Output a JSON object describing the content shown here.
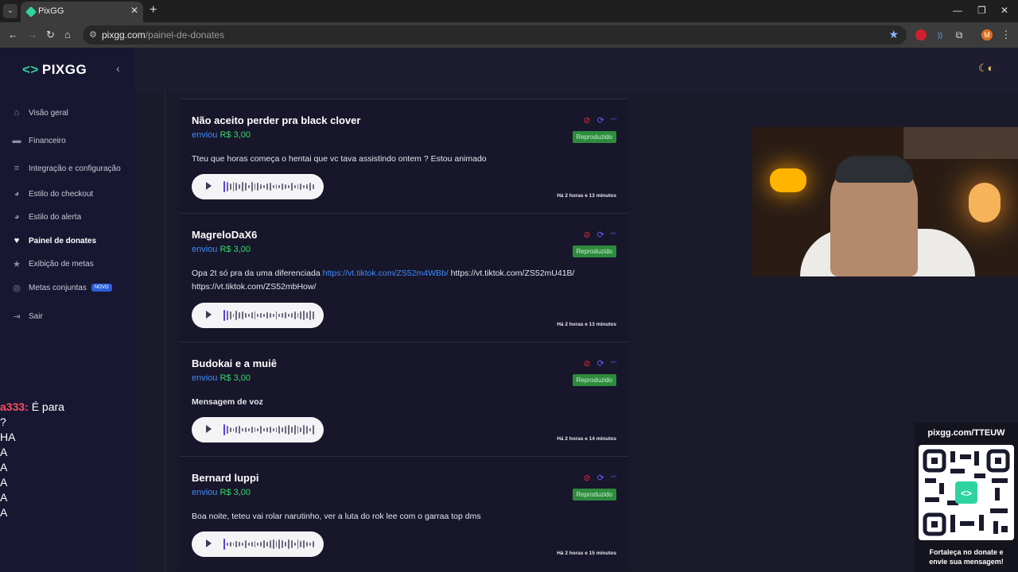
{
  "browser": {
    "tab_title": "PixGG",
    "url_host": "pixgg.com",
    "url_path": "/painel-de-donates",
    "profile_initial": "M"
  },
  "sidebar": {
    "logo": "PIXGG",
    "items": [
      {
        "label": "Visão geral",
        "icon": "home-icon"
      },
      {
        "label": "Financeiro",
        "icon": "wallet-icon"
      },
      {
        "label": "Integração e configuração",
        "icon": "settings-icon"
      },
      {
        "label": "Estilo do checkout",
        "icon": "palette-icon"
      },
      {
        "label": "Estilo do alerta",
        "icon": "palette-icon"
      },
      {
        "label": "Painel de donates",
        "icon": "donate-icon",
        "active": true
      },
      {
        "label": "Exibição de metas",
        "icon": "star-icon"
      },
      {
        "label": "Metas conjuntas",
        "icon": "target-icon",
        "badge": "NOVO"
      },
      {
        "label": "Sair",
        "icon": "logout-icon"
      }
    ]
  },
  "chat": {
    "lines": [
      "a333:",
      "É para",
      "?",
      "HA",
      "A",
      "A",
      "A",
      "A",
      "A"
    ]
  },
  "donates": [
    {
      "name": "Não aceito perder pra black clover",
      "sent_label": "enviou",
      "amount": "R$ 3,00",
      "message": "Tteu que horas começa o hentai que vc tava assistindo ontem ? Estou animado",
      "status": "Reproduzido",
      "time": "Há 2 horas e 13 minutos"
    },
    {
      "name": "MagreloDaX6",
      "sent_label": "enviou",
      "amount": "R$ 3,00",
      "message_pre": "Opa 2t só pra da uma diferenciada ",
      "message_link": "https://vt.tiktok.com/ZS52m4WBb/",
      "message_post": " https://vt.tiktok.com/ZS52mU41B/ https://vt.tiktok.com/ZS52mbHow/",
      "status": "Reproduzido",
      "time": "Há 2 horas e 13 minutos"
    },
    {
      "name": "Budokai e a muiê",
      "sent_label": "enviou",
      "amount": "R$ 3,00",
      "message": "Mensagem de voz",
      "status": "Reproduzido",
      "time": "Há 2 horas e 14 minutos"
    },
    {
      "name": "Bernard luppi",
      "sent_label": "enviou",
      "amount": "R$ 3,00",
      "message": "Boa noite, teteu vai rolar narutinho, ver a luta do rok lee com o garraa top dms",
      "status": "Reproduzido",
      "time": "Há 2 horas e 15 minutos"
    }
  ],
  "qr_widget": {
    "url": "pixgg.com/TTEUW",
    "footer_1": "Fortaleça no donate e",
    "footer_2": "envie sua mensagem!"
  },
  "colors": {
    "accent_blue": "#3f8bff",
    "amount_green": "#38d96b",
    "status_green": "#2e8b3d",
    "block_red": "#e0293a"
  }
}
